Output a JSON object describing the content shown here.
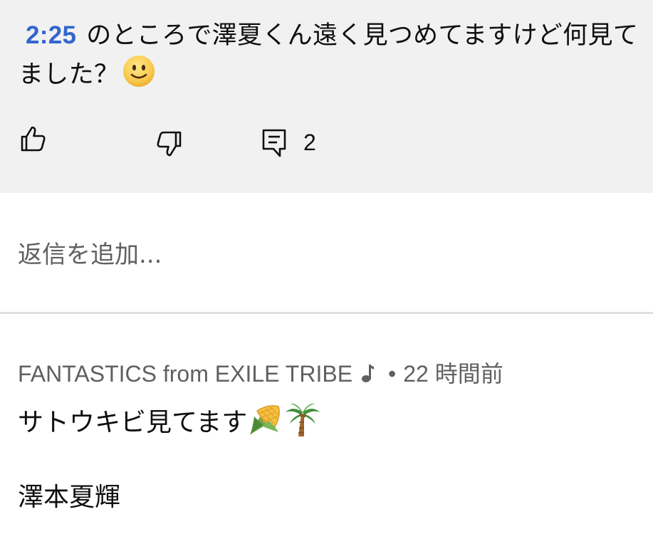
{
  "comment": {
    "timestamp_link": "2:25",
    "text": "のところで澤夏くん遠く見つめてますけど何見てました？",
    "emoji": "slightly-smiling-face",
    "reply_count": "2"
  },
  "actions": {
    "like_icon": "thumbs-up-icon",
    "dislike_icon": "thumbs-down-icon",
    "reply_icon": "comment-reply-icon"
  },
  "reply_input": {
    "placeholder": "返信を追加..."
  },
  "reply": {
    "author": "FANTASTICS from EXILE TRIBE",
    "author_badge_icon": "music-note-icon",
    "separator": "•",
    "time": "22 時間前",
    "body": "サトウキビ見てます",
    "emojis": [
      "ear-of-corn",
      "palm-tree"
    ],
    "signature": "澤本夏輝"
  },
  "colors": {
    "accent_link": "#3366cc",
    "card_background": "#f1f1f1",
    "secondary_text": "#606060",
    "divider": "#e0e0e0"
  }
}
